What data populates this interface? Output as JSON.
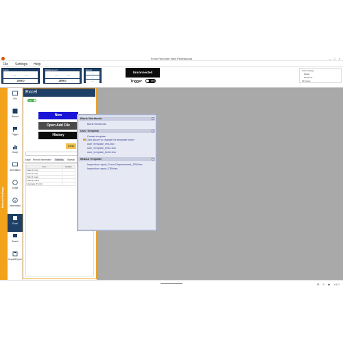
{
  "window": {
    "title": "Force Recorder Next Professional",
    "min": "–",
    "max": "□",
    "close": "×"
  },
  "menu": [
    "File",
    "Settings",
    "Help"
  ],
  "gauges": [
    {
      "label": "Force",
      "left": "---",
      "right": "---",
      "zero": "ZERO"
    },
    {
      "label": "Displacement",
      "left": "---",
      "right": "---",
      "zero": "ZERO"
    }
  ],
  "speed": {
    "label": "Speed",
    "values": [
      "---",
      "---",
      "---"
    ]
  },
  "connection": {
    "status": "Unconnected"
  },
  "trigger": {
    "label": "Trigger",
    "state": "OFF"
  },
  "force_gauge": {
    "title": "Force Gauge",
    "lines": [
      "Model",
      "Serial No.",
      "Firmware"
    ]
  },
  "sidebar": {
    "label": "Record Settings"
  },
  "nav": [
    {
      "label": "File",
      "icon": "folder-icon"
    },
    {
      "label": "Record",
      "icon": "gauge-icon"
    },
    {
      "label": "Trigger",
      "icon": "flag-icon"
    },
    {
      "label": "Graph",
      "icon": "chart-icon"
    },
    {
      "label": "Annotation",
      "icon": "comment-icon"
    },
    {
      "label": "Judge",
      "icon": "check-icon"
    },
    {
      "label": "Information",
      "icon": "info-icon"
    },
    {
      "label": "Excel",
      "icon": "excel-icon"
    },
    {
      "label": "Search",
      "icon": "search-icon"
    },
    {
      "label": "Import/Export",
      "icon": "save-icon"
    }
  ],
  "excel": {
    "title": "Excel",
    "toggle": "ON",
    "new_label": "New",
    "open_label": "Open  Add File",
    "history_label": "History",
    "clear_label": "Clear",
    "tabs": [
      "Judge",
      "Record information",
      "Statistics",
      "Statistic"
    ],
    "table": {
      "headers": [
        "Item",
        "Enable"
      ],
      "rows": [
        "Max (F min)",
        "Min (F min)",
        "Min (F max)",
        "Max (F max)",
        "Average (F min)"
      ]
    }
  },
  "popup": {
    "groups": [
      {
        "title": "Blank Workbook",
        "items": [
          "Blank Workbook"
        ]
      },
      {
        "title": "User Template",
        "items": [
          "Create template",
          "Click above to change the template folder",
          "user_template_test.xlsx",
          "user_template_test2.xlsx",
          "user_template_test3.xlsx"
        ]
      },
      {
        "title": "IMADA Template",
        "items": [
          "Inspection report_Force-Displacement_ZENxlsx",
          "Inspection report_ZENxlsx"
        ]
      }
    ]
  },
  "statusbar": {
    "version": "v1.0"
  }
}
